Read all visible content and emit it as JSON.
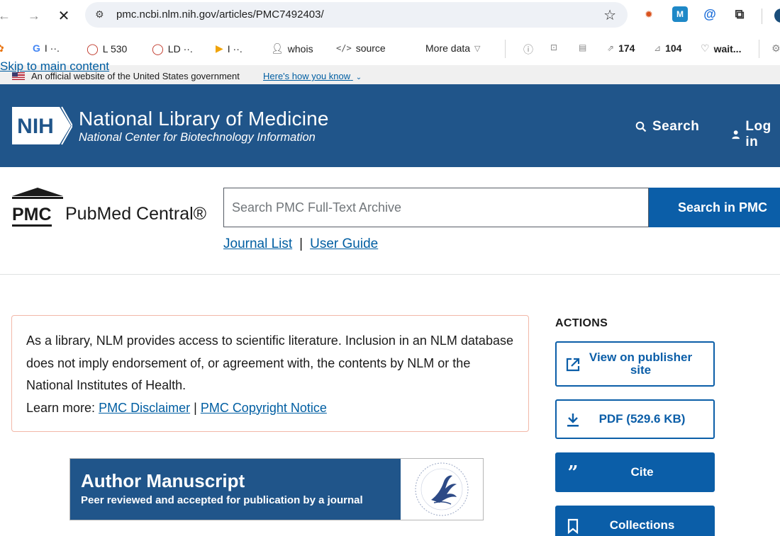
{
  "browser": {
    "url": "pmc.ncbi.nlm.nih.gov/articles/PMC7492403/",
    "bookmarks": [
      {
        "label": "I ··."
      },
      {
        "label": "L 530"
      },
      {
        "label": "LD ··."
      },
      {
        "label": "I ··."
      },
      {
        "label": "whois"
      },
      {
        "label": "source"
      },
      {
        "label": "More data"
      },
      {
        "label": "174"
      },
      {
        "label": "104"
      },
      {
        "label": "wait..."
      }
    ]
  },
  "skip_link": "Skip to main content",
  "gov_banner": {
    "text": "An official website of the United States government",
    "link": "Here's how you know"
  },
  "nlm_header": {
    "logo_text": "NIH",
    "title": "National Library of Medicine",
    "subtitle": "National Center for Biotechnology Information",
    "search_label": "Search",
    "login_label": "Log in"
  },
  "pmc": {
    "logo_box": "PMC",
    "logo_name": "PubMed Central®",
    "search_placeholder": "Search PMC Full-Text Archive",
    "search_button": "Search in PMC",
    "journal_list": "Journal List",
    "separator": "|",
    "user_guide": "User Guide"
  },
  "disclaimer": {
    "text": "As a library, NLM provides access to scientific literature. Inclusion in an NLM database does not imply endorsement of, or agreement with, the contents by NLM or the National Institutes of Health.",
    "learn_more": "Learn more:",
    "link1": "PMC Disclaimer",
    "sep": "|",
    "link2": "PMC Copyright Notice"
  },
  "author_manuscript": {
    "title": "Author Manuscript",
    "subtitle": "Peer reviewed and accepted for publication by a journal"
  },
  "actions": {
    "heading": "ACTIONS",
    "view_publisher": "View on publisher site",
    "pdf": "PDF (529.6 KB)",
    "cite": "Cite",
    "collections": "Collections"
  },
  "colors": {
    "header_blue": "#20558a",
    "button_blue": "#0b5ea8",
    "link_blue": "#005ea2"
  }
}
